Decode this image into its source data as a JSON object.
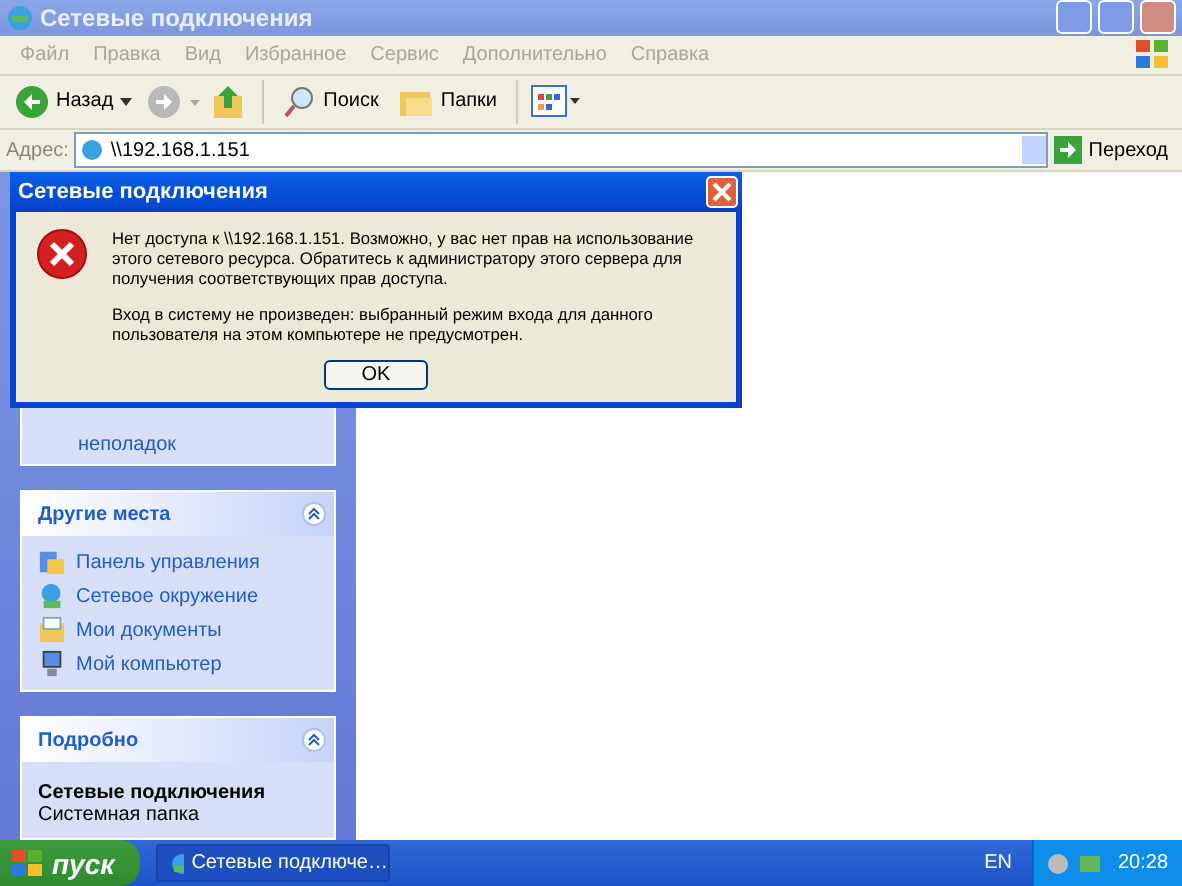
{
  "window": {
    "title": "Сетевые подключения"
  },
  "menu": [
    {
      "label": "Файл"
    },
    {
      "label": "Правка"
    },
    {
      "label": "Вид"
    },
    {
      "label": "Избранное"
    },
    {
      "label": "Сервис"
    },
    {
      "label": "Дополнительно"
    },
    {
      "label": "Справка"
    }
  ],
  "toolbar": {
    "back": "Назад",
    "search": "Поиск",
    "folders": "Папки"
  },
  "address": {
    "label": "Адрес:",
    "value": "\\\\192.168.1.151",
    "go": "Переход"
  },
  "sidebar": {
    "panels": [
      {
        "items": [
          {
            "label": "неполадок"
          }
        ]
      },
      {
        "title": "Другие места",
        "items": [
          {
            "label": "Панель управления"
          },
          {
            "label": "Сетевое окружение"
          },
          {
            "label": "Мои документы"
          },
          {
            "label": "Мой компьютер"
          }
        ]
      }
    ],
    "details": {
      "title": "Подробно",
      "name": "Сетевые подключения",
      "type": "Системная папка"
    }
  },
  "dialog": {
    "title": "Сетевые подключения",
    "messages": [
      "Нет доступа к \\\\192.168.1.151. Возможно, у вас нет прав на использование этого сетевого ресурса. Обратитесь к администратору этого сервера для получения соответствующих прав доступа.",
      "Вход в систему не произведен: выбранный режим входа для данного пользователя на этом компьютере не предусмотрен."
    ],
    "button": "OK"
  },
  "taskbar": {
    "start": "пуск",
    "task": "Сетевые подключе…",
    "language": "EN",
    "clock": "20:28"
  }
}
